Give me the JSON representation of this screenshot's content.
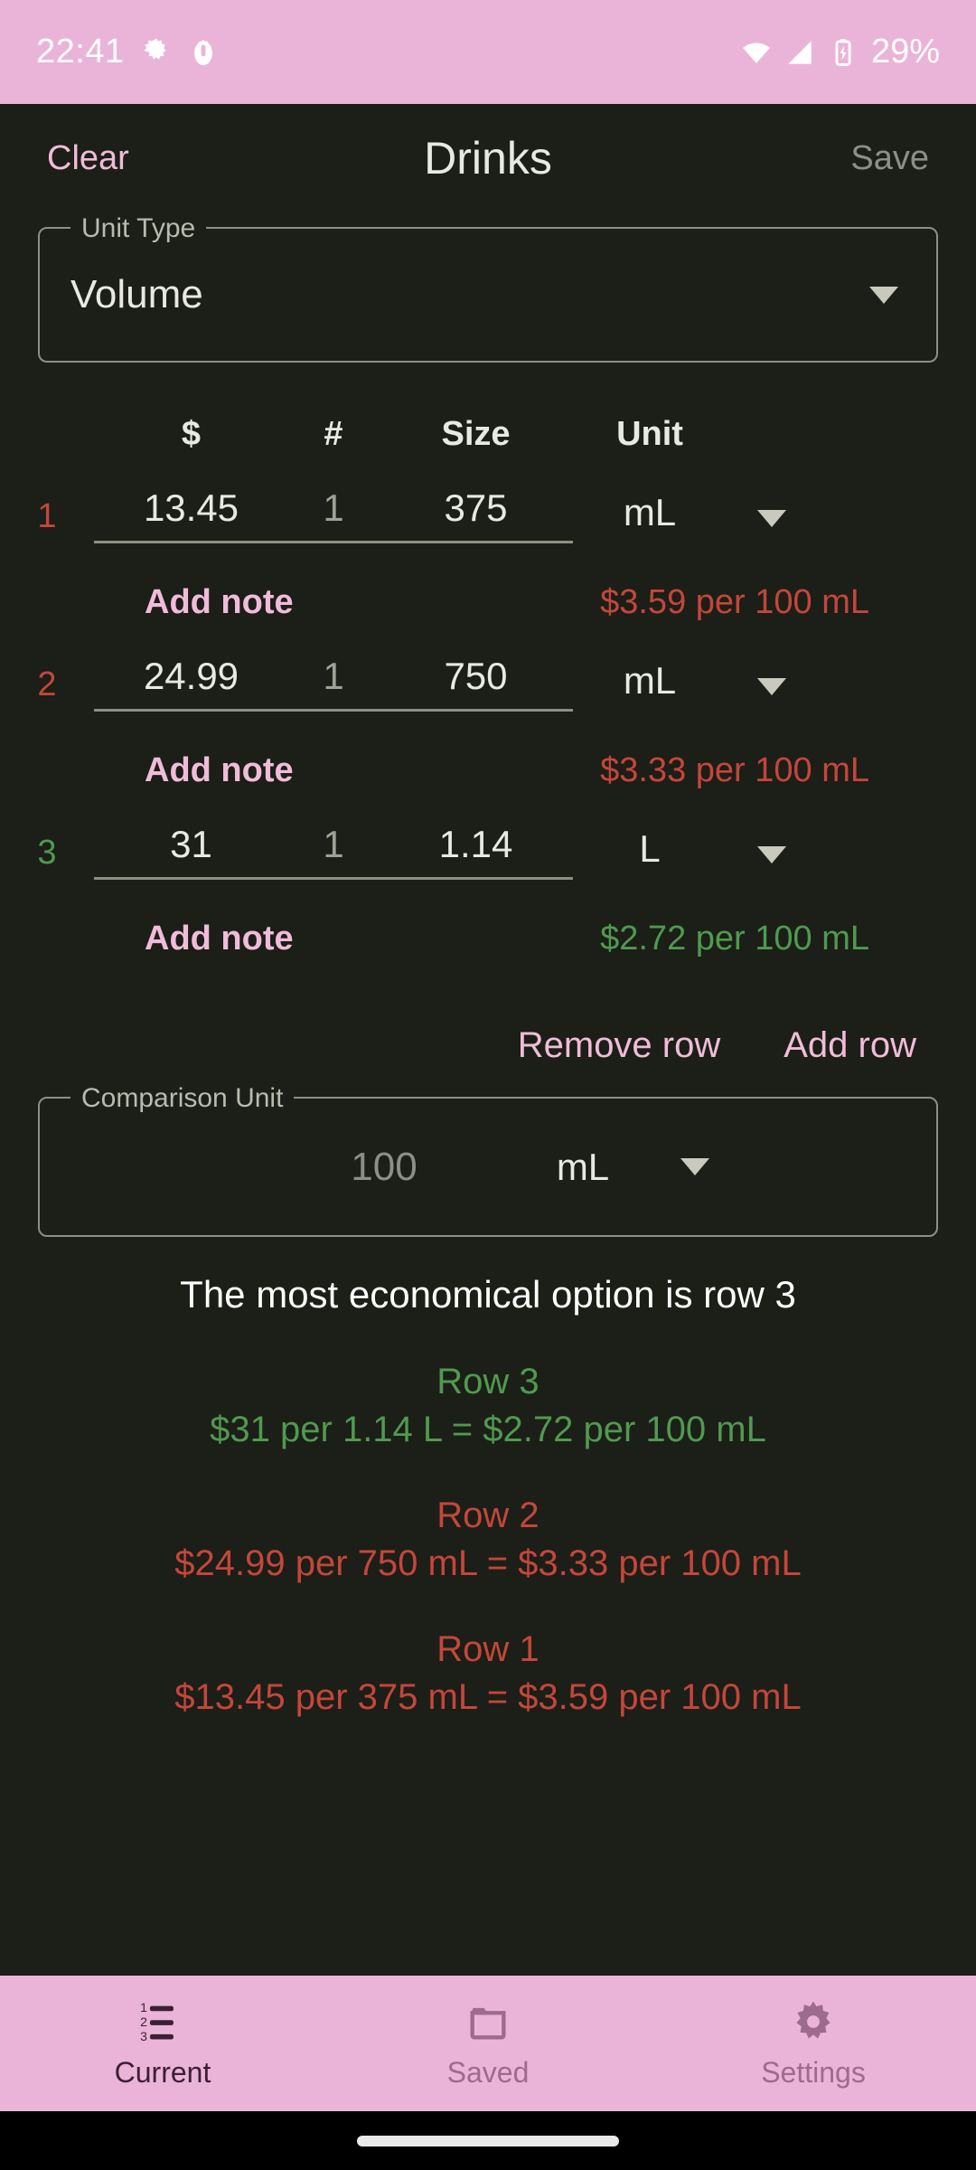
{
  "status_bar": {
    "time": "22:41",
    "battery_text": "29%",
    "icons": [
      "gear-icon",
      "bug-droid-icon",
      "wifi-icon",
      "cell-signal-icon",
      "battery-charging-icon"
    ]
  },
  "app_bar": {
    "clear_label": "Clear",
    "title": "Drinks",
    "save_label": "Save"
  },
  "unit_type": {
    "legend": "Unit Type",
    "value": "Volume"
  },
  "table": {
    "headers": {
      "index": "",
      "price": "$",
      "quantity": "#",
      "size": "Size",
      "unit": "Unit"
    },
    "rows": [
      {
        "index": "1",
        "price": "13.45",
        "quantity": "1",
        "size": "375",
        "unit": "mL",
        "note_label": "Add note",
        "unit_price": "$3.59 per 100 mL",
        "status": "bad"
      },
      {
        "index": "2",
        "price": "24.99",
        "quantity": "1",
        "size": "750",
        "unit": "mL",
        "note_label": "Add note",
        "unit_price": "$3.33 per 100 mL",
        "status": "bad"
      },
      {
        "index": "3",
        "price": "31",
        "quantity": "1",
        "size": "1.14",
        "unit": "L",
        "note_label": "Add note",
        "unit_price": "$2.72 per 100 mL",
        "status": "good"
      }
    ]
  },
  "row_actions": {
    "remove_label": "Remove row",
    "add_label": "Add row"
  },
  "comparison_unit": {
    "legend": "Comparison Unit",
    "amount": "100",
    "unit": "mL"
  },
  "results": {
    "summary": "The most economical option is row 3",
    "entries": [
      {
        "title": "Row 3",
        "detail": "$31 per 1.14 L = $2.72 per 100 mL",
        "status": "good"
      },
      {
        "title": "Row 2",
        "detail": "$24.99 per 750 mL = $3.33 per 100 mL",
        "status": "bad"
      },
      {
        "title": "Row 1",
        "detail": "$13.45 per 375 mL = $3.59 per 100 mL",
        "status": "bad"
      }
    ]
  },
  "bottom_nav": {
    "items": [
      {
        "label": "Current",
        "icon": "numbered-list-icon",
        "active": true
      },
      {
        "label": "Saved",
        "icon": "folder-icon",
        "active": false
      },
      {
        "label": "Settings",
        "icon": "gear-icon",
        "active": false
      }
    ]
  },
  "colors": {
    "background": "#1c1e18",
    "accent_pink": "#eab4d8",
    "accent_pink_text": "#f0bcd8",
    "bad": "#c4463a",
    "good": "#4f9a4f",
    "text_primary": "#e8e9e0",
    "text_muted": "#8d8f86"
  }
}
